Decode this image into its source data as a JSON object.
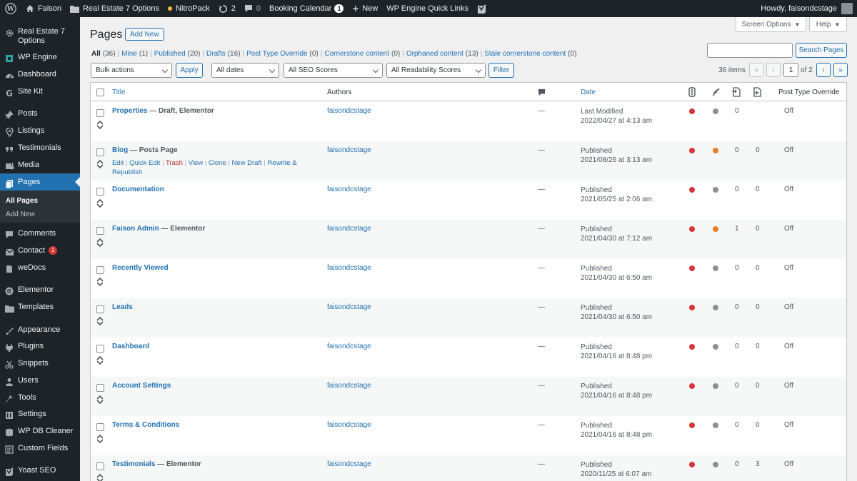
{
  "adminbar": {
    "site_name": "Faison",
    "theme_options": "Real Estate 7 Options",
    "nitropack": "NitroPack",
    "updates_count": "2",
    "comments_count": "0",
    "booking": "Booking Calendar",
    "booking_count": "1",
    "new": "New",
    "wp_engine_links": "WP Engine Quick Links",
    "howdy": "Howdy, faisondcstage"
  },
  "sidebar": {
    "items": [
      {
        "label": "Real Estate 7 Options",
        "icon": "gear-icon"
      },
      {
        "label": "WP Engine",
        "icon": "wpengine-icon"
      },
      {
        "label": "Dashboard",
        "icon": "dashboard-icon"
      },
      {
        "label": "Site Kit",
        "icon": "sitekit-icon"
      },
      {
        "label": "Posts",
        "icon": "pin-icon"
      },
      {
        "label": "Listings",
        "icon": "location-icon"
      },
      {
        "label": "Testimonials",
        "icon": "quote-icon"
      },
      {
        "label": "Media",
        "icon": "media-icon"
      },
      {
        "label": "Pages",
        "icon": "pages-icon"
      },
      {
        "label": "Comments",
        "icon": "comments-icon"
      },
      {
        "label": "Contact",
        "icon": "mail-icon",
        "badge": "1"
      },
      {
        "label": "weDocs",
        "icon": "docs-icon"
      },
      {
        "label": "Elementor",
        "icon": "elementor-icon"
      },
      {
        "label": "Templates",
        "icon": "folder-icon"
      },
      {
        "label": "Appearance",
        "icon": "brush-icon"
      },
      {
        "label": "Plugins",
        "icon": "plugin-icon"
      },
      {
        "label": "Snippets",
        "icon": "scissors-icon"
      },
      {
        "label": "Users",
        "icon": "users-icon"
      },
      {
        "label": "Tools",
        "icon": "wrench-icon"
      },
      {
        "label": "Settings",
        "icon": "settings-icon"
      },
      {
        "label": "WP DB Cleaner",
        "icon": "database-icon"
      },
      {
        "label": "Custom Fields",
        "icon": "fields-icon"
      },
      {
        "label": "Yoast SEO",
        "icon": "yoast-icon"
      }
    ],
    "submenu": [
      "All Pages",
      "Add New"
    ]
  },
  "header": {
    "title": "Pages",
    "add_new": "Add New",
    "screen_options": "Screen Options",
    "help": "Help"
  },
  "filters": {
    "views": [
      {
        "label": "All",
        "count": "(36)"
      },
      {
        "label": "Mine",
        "count": "(1)"
      },
      {
        "label": "Published",
        "count": "(20)"
      },
      {
        "label": "Drafts",
        "count": "(16)"
      },
      {
        "label": "Post Type Override",
        "count": "(0)"
      },
      {
        "label": "Cornerstone content",
        "count": "(0)"
      },
      {
        "label": "Orphaned content",
        "count": "(13)"
      },
      {
        "label": "Stale cornerstone content",
        "count": "(0)"
      }
    ],
    "search_button": "Search Pages",
    "bulk_actions": "Bulk actions",
    "apply": "Apply",
    "dates": "All dates",
    "seo": "All SEO Scores",
    "readability": "All Readability Scores",
    "filter": "Filter",
    "items_count": "36 items",
    "page_current": "1",
    "page_of": "of 2"
  },
  "table": {
    "columns": {
      "title": "Title",
      "authors": "Authors",
      "date": "Date",
      "override": "Post Type Override"
    },
    "row_actions": {
      "edit": "Edit",
      "quick_edit": "Quick Edit",
      "trash": "Trash",
      "view": "View",
      "clone": "Clone",
      "new_draft": "New Draft",
      "rewrite": "Rewrite & Republish"
    },
    "rows": [
      {
        "title": "Properties",
        "state": " — Draft, Elementor",
        "author": "faisondcstage",
        "comments": "—",
        "status": "Last Modified",
        "date": "2022/04/27 at 4:13 am",
        "readability_color": "#8c8f94",
        "links": "0",
        "linked": "",
        "override": "Off"
      },
      {
        "title": "Blog",
        "state": " — Posts Page",
        "author": "faisondcstage",
        "comments": "—",
        "status": "Published",
        "date": "2021/08/26 at 3:13 am",
        "readability_color": "#e67e22",
        "links": "0",
        "linked": "0",
        "override": "Off"
      },
      {
        "title": "Documentation",
        "state": "",
        "author": "faisondcstage",
        "comments": "—",
        "status": "Published",
        "date": "2021/05/25 at 2:06 am",
        "readability_color": "#8c8f94",
        "links": "0",
        "linked": "0",
        "override": "Off"
      },
      {
        "title": "Faison Admin",
        "state": " — Elementor",
        "author": "faisondcstage",
        "comments": "—",
        "status": "Published",
        "date": "2021/04/30 at 7:12 am",
        "readability_color": "#e67e22",
        "links": "1",
        "linked": "0",
        "override": "Off"
      },
      {
        "title": "Recently Viewed",
        "state": "",
        "author": "faisondcstage",
        "comments": "—",
        "status": "Published",
        "date": "2021/04/30 at 6:50 am",
        "readability_color": "#8c8f94",
        "links": "0",
        "linked": "0",
        "override": "Off"
      },
      {
        "title": "Leads",
        "state": "",
        "author": "faisondcstage",
        "comments": "—",
        "status": "Published",
        "date": "2021/04/30 at 6:50 am",
        "readability_color": "#8c8f94",
        "links": "0",
        "linked": "0",
        "override": "Off"
      },
      {
        "title": "Dashboard",
        "state": "",
        "author": "faisondcstage",
        "comments": "—",
        "status": "Published",
        "date": "2021/04/16 at 8:48 pm",
        "readability_color": "#8c8f94",
        "links": "0",
        "linked": "0",
        "override": "Off"
      },
      {
        "title": "Account Settings",
        "state": "",
        "author": "faisondcstage",
        "comments": "—",
        "status": "Published",
        "date": "2021/04/16 at 8:48 pm",
        "readability_color": "#8c8f94",
        "links": "0",
        "linked": "0",
        "override": "Off"
      },
      {
        "title": "Terms & Conditions",
        "state": "",
        "author": "faisondcstage",
        "comments": "—",
        "status": "Published",
        "date": "2021/04/16 at 8:48 pm",
        "readability_color": "#8c8f94",
        "links": "0",
        "linked": "0",
        "override": "Off"
      },
      {
        "title": "Testimonials",
        "state": " — Elementor",
        "author": "faisondcstage",
        "comments": "—",
        "status": "Published",
        "date": "2020/11/25 at 6:07 am",
        "readability_color": "#8c8f94",
        "links": "0",
        "linked": "3",
        "override": "Off"
      }
    ]
  },
  "colors": {
    "seo_red": "#d63638",
    "accent": "#2271b1",
    "current_menu": "#2271b1"
  }
}
